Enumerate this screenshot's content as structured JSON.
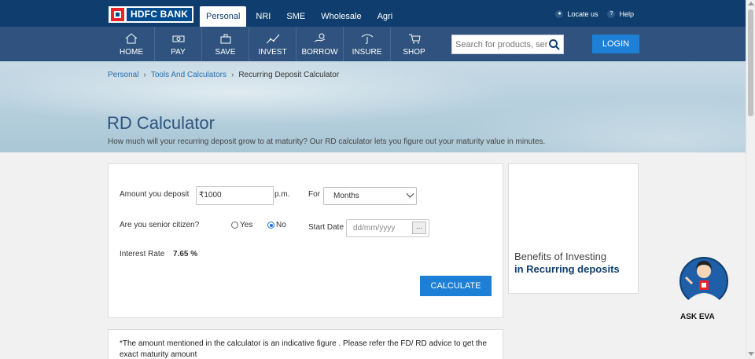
{
  "brand": {
    "logo_text": "HDFC BANK",
    "primary_color": "#0f3e6e",
    "accent_color": "#1d7fd6"
  },
  "segment_tabs": [
    "Personal",
    "NRI",
    "SME",
    "Wholesale",
    "Agri"
  ],
  "segment_active": "Personal",
  "top_links": {
    "locate": "Locate us",
    "help": "Help"
  },
  "nav": [
    {
      "label": "HOME",
      "icon": "home-icon"
    },
    {
      "label": "PAY",
      "icon": "pay-icon"
    },
    {
      "label": "SAVE",
      "icon": "save-icon"
    },
    {
      "label": "INVEST",
      "icon": "invest-icon"
    },
    {
      "label": "BORROW",
      "icon": "borrow-icon"
    },
    {
      "label": "INSURE",
      "icon": "insure-icon"
    },
    {
      "label": "SHOP",
      "icon": "shop-icon"
    }
  ],
  "search": {
    "placeholder": "Search for products, ser"
  },
  "login_label": "LOGIN",
  "breadcrumb": {
    "level1": "Personal",
    "level2": "Tools And Calculators",
    "current": "Recurring Deposit Calculator"
  },
  "hero": {
    "title": "RD Calculator",
    "subtitle": "How much will your recurring deposit grow to at maturity? Our RD calculator lets you figure out your maturity value in minutes."
  },
  "calculator": {
    "amount_label": "Amount you deposit",
    "amount_value": "₹1000",
    "amount_suffix": "p.m.",
    "for_label": "For",
    "for_selected": "Months",
    "senior_label": "Are you senior citizen?",
    "yes_label": "Yes",
    "no_label": "No",
    "senior_selected": "No",
    "start_date_label": "Start Date",
    "start_date_placeholder": "dd/mm/yyyy",
    "date_button": "...",
    "rate_label": "Interest Rate",
    "rate_value": "7.65 %",
    "calculate_label": "CALCULATE"
  },
  "side_card": {
    "line1": "Benefits of Investing",
    "line2": "in Recurring deposits"
  },
  "note": "*The amount mentioned in the calculator is an indicative figure . Please refer the FD/ RD advice to get the exact maturity amount",
  "assistant": {
    "label": "ASK EVA"
  }
}
